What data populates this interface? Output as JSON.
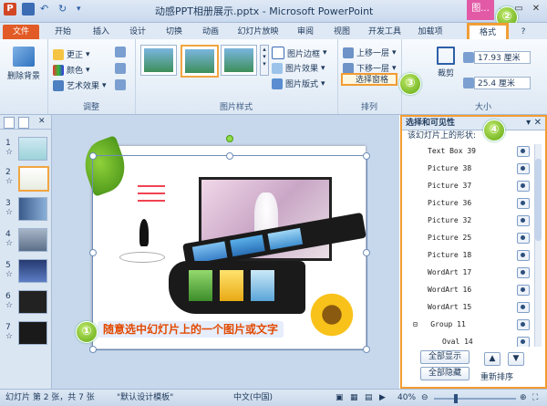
{
  "titlebar": {
    "title": "动感PPT相册展示.pptx - Microsoft PowerPoint",
    "context_tab": "图..."
  },
  "tabs": [
    "文件",
    "开始",
    "插入",
    "设计",
    "切换",
    "动画",
    "幻灯片放映",
    "审阅",
    "视图",
    "开发工具",
    "加载项",
    "格式"
  ],
  "ribbon": {
    "remove_bg": "删除背景",
    "adjust": {
      "corrections": "更正",
      "color": "颜色",
      "artistic": "艺术效果",
      "label": "调整"
    },
    "styles": {
      "border": "图片边框",
      "effects": "图片效果",
      "layout": "图片版式",
      "label": "图片样式"
    },
    "arrange": {
      "bring_forward": "上移一层",
      "send_backward": "下移一层",
      "selection_pane": "选择窗格",
      "label": "排列"
    },
    "size": {
      "crop": "裁剪",
      "height": "17.93 厘米",
      "width": "25.4 厘米",
      "label": "大小"
    }
  },
  "slides": [
    {
      "num": "1",
      "mark": "☆"
    },
    {
      "num": "2",
      "mark": "☆"
    },
    {
      "num": "3",
      "mark": "☆"
    },
    {
      "num": "4",
      "mark": "☆"
    },
    {
      "num": "5",
      "mark": "☆"
    },
    {
      "num": "6",
      "mark": "☆"
    },
    {
      "num": "7",
      "mark": "☆"
    }
  ],
  "caption": "随意选中幻灯片上的一个图片或文字",
  "badges": {
    "one": "①",
    "two": "②",
    "three": "③",
    "four": "④"
  },
  "pane": {
    "title": "选择和可见性",
    "subtitle": "该幻灯片上的形状:",
    "items": [
      "Text Box 39",
      "Picture 38",
      "Picture 37",
      "Picture 36",
      "Picture 32",
      "Picture 25",
      "Picture 18",
      "WordArt 17",
      "WordArt 16",
      "WordArt 15",
      "Group 11",
      "Oval 14"
    ],
    "group_marker": "⊟",
    "show_all": "全部显示",
    "hide_all": "全部隐藏",
    "reorder": "重新排序"
  },
  "status": {
    "slide": "幻灯片 第 2 张，共 7 张",
    "theme": "\"默认设计模板\"",
    "lang": "中文(中国)",
    "zoom": "40%"
  },
  "colors": {
    "accent": "#f39c33",
    "file_tab": "#e25b26",
    "context": "#e25aa6"
  }
}
